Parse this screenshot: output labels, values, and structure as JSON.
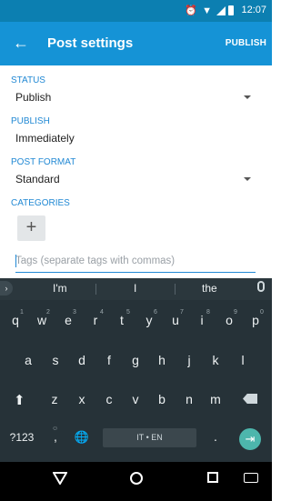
{
  "status_bar": {
    "time": "12:07",
    "icons": [
      "alarm-icon",
      "wifi-icon",
      "signal-icon",
      "battery-icon"
    ]
  },
  "app_bar": {
    "title": "Post settings",
    "action_label": "PUBLISH",
    "back_icon": "arrow-back-icon"
  },
  "form": {
    "status": {
      "label": "STATUS",
      "value": "Publish"
    },
    "publish": {
      "label": "PUBLISH",
      "value": "Immediately"
    },
    "post_format": {
      "label": "POST FORMAT",
      "value": "Standard"
    },
    "categories": {
      "label": "CATEGORIES",
      "add_symbol": "+"
    },
    "tags": {
      "placeholder": "Tags (separate tags with commas)"
    }
  },
  "keyboard": {
    "suggestions": [
      "I'm",
      "I",
      "the"
    ],
    "row1": [
      "q",
      "w",
      "e",
      "r",
      "t",
      "y",
      "u",
      "i",
      "o",
      "p"
    ],
    "row1_alt": [
      "1",
      "2",
      "3",
      "4",
      "5",
      "6",
      "7",
      "8",
      "9",
      "0"
    ],
    "row2": [
      "a",
      "s",
      "d",
      "f",
      "g",
      "h",
      "j",
      "k",
      "l"
    ],
    "row3": [
      "z",
      "x",
      "c",
      "v",
      "b",
      "n",
      "m"
    ],
    "symbols_label": "?123",
    "comma": ",",
    "comma_alt": "☺",
    "globe": "🌐",
    "space_label": "IT • EN",
    "period": ".",
    "enter_symbol": "⇥"
  },
  "colors": {
    "status_bar": "#0c7fb1",
    "app_bar": "#1593d6",
    "accent": "#2289d4",
    "keyboard_bg": "#263238",
    "enter_key": "#4db6ac"
  }
}
